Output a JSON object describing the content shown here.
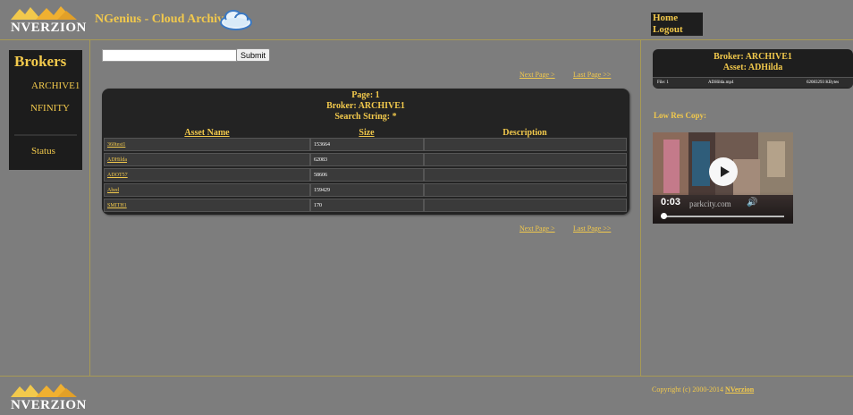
{
  "header": {
    "logo_text": "NVERZION",
    "app_title": "NGenius - Cloud Archive",
    "nav": [
      "Home",
      "Logout"
    ]
  },
  "sidebar": {
    "title": "Brokers",
    "items": [
      "ARCHIVE1",
      "NFINITY",
      "Status"
    ]
  },
  "search": {
    "value": "",
    "placeholder": "",
    "submit_label": "Submit"
  },
  "pager": {
    "next": "Next Page >",
    "last": "Last Page >>"
  },
  "results": {
    "page_line": "Page: 1",
    "broker_line": "Broker: ARCHIVE1",
    "search_line": "Search String: *",
    "columns": [
      "Asset Name",
      "Size",
      "Description"
    ],
    "rows": [
      {
        "name": "360test1",
        "size": "153664",
        "desc": ""
      },
      {
        "name": "ADHilda",
        "size": "62083",
        "desc": ""
      },
      {
        "name": "ADOT57",
        "size": "58606",
        "desc": ""
      },
      {
        "name": "Abed",
        "size": "159429",
        "desc": ""
      },
      {
        "name": "SMITH1",
        "size": "170",
        "desc": ""
      }
    ]
  },
  "detail": {
    "broker_line": "Broker: ARCHIVE1",
    "asset_line": "Asset: ADHilda",
    "file_label": "File: 1",
    "file_name": "ADHilda.mp4",
    "file_size": "62083293 KBytes",
    "lowres_label": "Low Res Copy:",
    "video_time": "0:03",
    "video_watermark": "parkcity.com"
  },
  "footer": {
    "logo_text": "NVERZION",
    "copyright": "Copyright (c) 2000-2014 ",
    "company": "NVerzion"
  },
  "colors": {
    "accent": "#f2c94c",
    "background": "#7d7d7d",
    "panel": "#1e1e1e"
  }
}
